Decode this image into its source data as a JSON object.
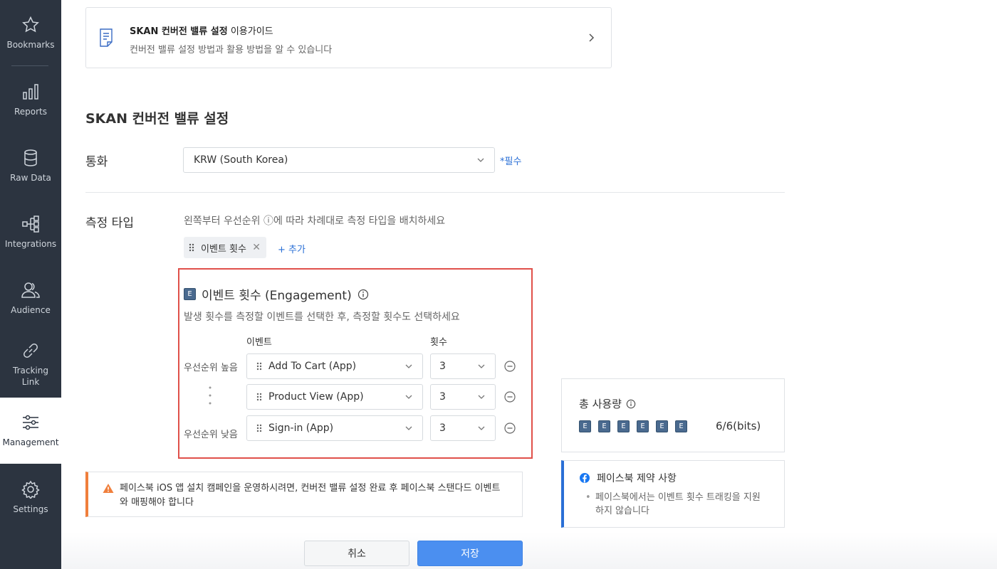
{
  "sidebar": {
    "items": [
      {
        "label": "Bookmarks",
        "icon": "star-icon"
      },
      {
        "label": "Reports",
        "icon": "bar-chart-icon"
      },
      {
        "label": "Raw Data",
        "icon": "database-icon"
      },
      {
        "label": "Integrations",
        "icon": "integrations-icon"
      },
      {
        "label": "Audience",
        "icon": "audience-icon"
      },
      {
        "label": "Tracking Link",
        "icon": "link-icon"
      },
      {
        "label": "Management",
        "icon": "sliders-icon",
        "active": true
      },
      {
        "label": "Settings",
        "icon": "gear-icon"
      }
    ]
  },
  "guide": {
    "title_bold": "SKAN 컨버전 밸류 설정",
    "title_rest": " 이용가이드",
    "description": "컨버전 밸류 설정 방법과 활용 방법을 알 수 있습니다"
  },
  "page_title": "SKAN 컨버전 밸류 설정",
  "currency": {
    "label": "통화",
    "value": "KRW (South Korea)",
    "required": "*필수"
  },
  "measure": {
    "label": "측정 타입",
    "hint": "왼쪽부터 우선순위 ⓘ에 따라 차례대로 측정 타입을 배치하세요",
    "chip": "이벤트 횟수",
    "add": "+ 추가"
  },
  "engagement": {
    "badge": "E",
    "title": "이벤트 횟수 (Engagement)",
    "description": "발생 횟수를 측정할 이벤트를 선택한 후, 측정할 횟수도 선택하세요",
    "col_event": "이벤트",
    "col_count": "횟수",
    "priority_high": "우선순위 높음",
    "priority_low": "우선순위 낮음",
    "rows": [
      {
        "event": "Add To Cart (App)",
        "count": "3"
      },
      {
        "event": "Product View (App)",
        "count": "3"
      },
      {
        "event": "Sign-in (App)",
        "count": "3"
      }
    ]
  },
  "usage": {
    "title": "총 사용량",
    "badge": "E",
    "value": "6/6(bits)"
  },
  "facebook": {
    "title": "페이스북 제약 사항",
    "note": "페이스북에서는 이벤트 횟수 트래킹을 지원하지 않습니다"
  },
  "warning": {
    "text": "페이스북 iOS 앱 설치 캠페인을 운영하시려면, 컨버전 밸류 설정 완료 후 페이스북 스탠다드 이벤트와 매핑해야 합니다"
  },
  "buttons": {
    "cancel": "취소",
    "save": "저장"
  },
  "colors": {
    "sidebar_bg": "#2c3440",
    "accent": "#4b8ff0",
    "highlight_border": "#e0504a",
    "warning": "#f07f3c"
  }
}
